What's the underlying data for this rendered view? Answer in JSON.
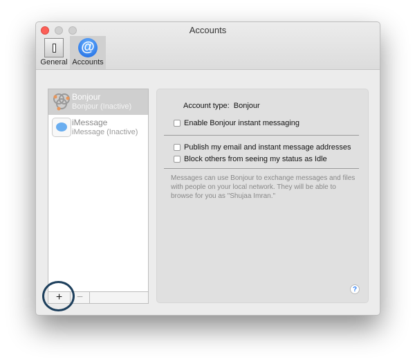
{
  "window": {
    "title": "Accounts"
  },
  "toolbar": {
    "items": [
      {
        "label": "General",
        "icon": "switch-icon"
      },
      {
        "label": "Accounts",
        "icon": "at-sign-icon",
        "selected": true
      }
    ]
  },
  "accounts": [
    {
      "name": "Bonjour",
      "status": "Bonjour (Inactive)",
      "icon": "bonjour-icon",
      "selected": true
    },
    {
      "name": "iMessage",
      "status": "iMessage (Inactive)",
      "icon": "imessage-icon"
    }
  ],
  "list_buttons": {
    "add": "+",
    "remove": "−"
  },
  "detail": {
    "account_type_label": "Account type:",
    "account_type_value": "Bonjour",
    "checkboxes": [
      {
        "label": "Enable Bonjour instant messaging",
        "checked": false
      },
      {
        "label": "Publish my email and instant message addresses",
        "checked": false
      },
      {
        "label": "Block others from seeing my status as Idle",
        "checked": false
      }
    ],
    "description": "Messages can use Bonjour to exchange messages and files with people on your local network.  They will be able to browse for you as \"Shujaa Imran.\"",
    "help": "?"
  },
  "colors": {
    "accent": "#2a7df5",
    "highlight_circle": "#1d3f5c"
  }
}
